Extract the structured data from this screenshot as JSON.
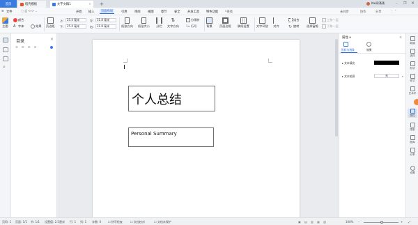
{
  "titlebar": {
    "home_tab": "首页",
    "tabs": [
      {
        "label": "稻壳模板",
        "color": "#e5532d"
      },
      {
        "label": "文字文稿1",
        "color": "#3a7be0"
      }
    ],
    "add_tab": "+",
    "user_name": "Kai闻涌涌",
    "window_controls": [
      "minimize",
      "restore",
      "close"
    ]
  },
  "menubar": {
    "file_menu": "文件",
    "items": [
      "开始",
      "插入",
      "页面布局",
      "引用",
      "审阅",
      "视图",
      "章节",
      "安全",
      "开发工具",
      "特色功能"
    ],
    "active_item": "页面布局",
    "search_placeholder": "查找",
    "right_actions": [
      "未同步",
      "协作",
      "分享"
    ]
  },
  "ribbon": {
    "theme": "主题",
    "colors": "颜色",
    "fonts": "字体",
    "effects": "效果",
    "margins": "页边距",
    "top_label": "上:",
    "top_value": "25.4 毫米",
    "bottom_label": "下:",
    "bottom_value": "25.4 毫米",
    "left_label": "左:",
    "left_value": "31.8 毫米",
    "right_label": "右:",
    "right_value": "31.8 毫米",
    "orientation": "纸张方向",
    "size": "纸张大小",
    "columns": "分栏",
    "text_direction": "文字方向",
    "line_numbers": "行号",
    "breaks": "分隔符",
    "background": "背景",
    "page_border": "页面边框",
    "draft_settings": "稿纸设置",
    "wrap_text": "文字环绕",
    "align": "对齐",
    "rotate": "旋转",
    "group": "组合",
    "select_pane": "选择窗格",
    "bring_forward": "上移一层",
    "send_backward": "下移一层"
  },
  "outline_panel": {
    "title": "目录",
    "close": "×"
  },
  "document": {
    "title_box_text": "个人总结",
    "subtitle_box_text": "Personal Summary"
  },
  "properties_panel": {
    "header": "属性",
    "tabs": [
      "形状与线条",
      "效果"
    ],
    "active_tab": "形状与线条",
    "fill_label": "文本填充",
    "fill_color": "#000000",
    "outline_label": "文本轮廓",
    "outline_value": "无"
  },
  "right_sidebar": {
    "items": [
      "新建",
      "选择",
      "形状",
      "样式",
      "艺术字",
      "属性",
      "限制",
      "图库",
      "分享",
      "设置"
    ]
  },
  "statusbar": {
    "page_num": "页码: 1",
    "pages": "页面: 1/1",
    "section": "节: 1/1",
    "setting": "设置值: 2.5厘米",
    "row": "行: 1",
    "col": "列: 1",
    "word_count": "字数: 0",
    "spell_check": "拼写检查",
    "doc_proof": "文档校对",
    "doc_unprotected": "文档未保护",
    "zoom": "100%"
  }
}
